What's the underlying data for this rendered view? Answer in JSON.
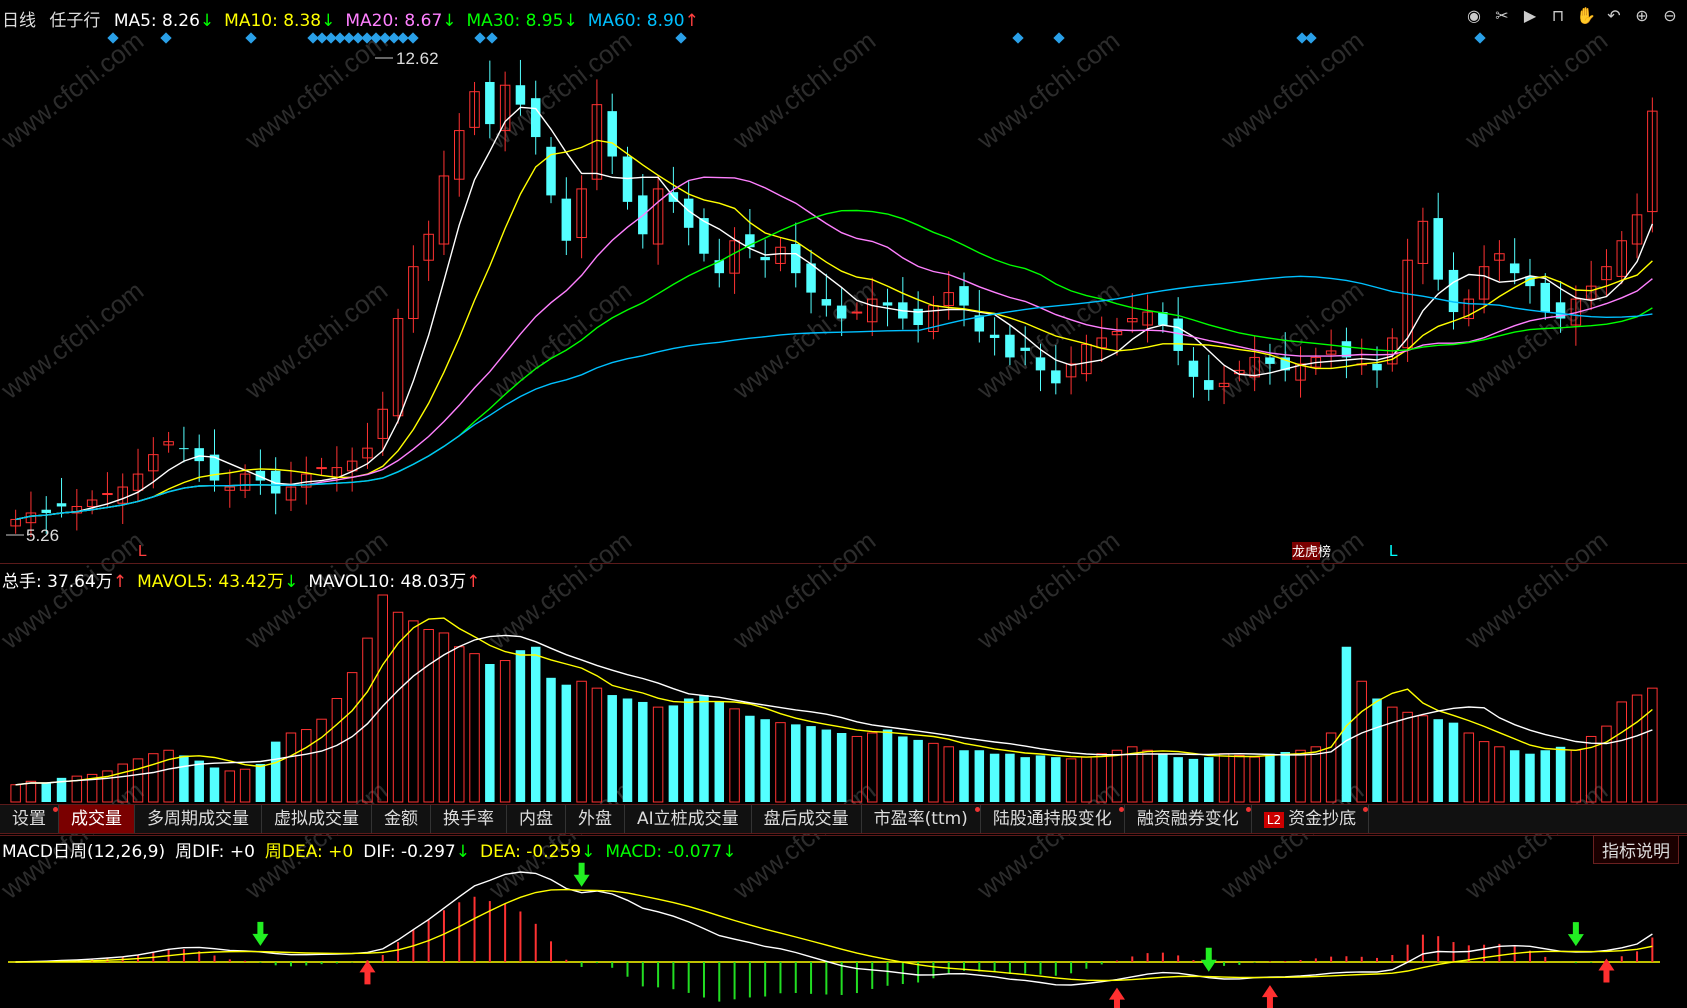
{
  "header": {
    "period": "日线",
    "stock": "任子行",
    "ma": [
      {
        "label": "MA5: 8.26",
        "arrow": "↓",
        "color": "#ffffff"
      },
      {
        "label": "MA10: 8.38",
        "arrow": "↓",
        "color": "#ffff00"
      },
      {
        "label": "MA20: 8.67",
        "arrow": "↓",
        "color": "#ff80ff"
      },
      {
        "label": "MA30: 8.95",
        "arrow": "↓",
        "color": "#00ff00"
      },
      {
        "label": "MA60: 8.90",
        "arrow": "↑",
        "color": "#00c0ff"
      }
    ]
  },
  "toolbar_icons": [
    "eye-icon",
    "scissors-icon",
    "play-icon",
    "lock-icon",
    "hand-icon",
    "undo-icon",
    "zoom-in-icon",
    "zoom-out-icon"
  ],
  "price_pane": {
    "high_label": "12.62",
    "low_label": "5.26",
    "markers": [
      "L",
      "L"
    ],
    "tag": "龙虎榜"
  },
  "volume_pane": {
    "items": [
      {
        "label": "总手: 37.64万",
        "arrow": "↑",
        "color": "#ffffff"
      },
      {
        "label": "MAVOL5: 43.42万",
        "arrow": "↓",
        "color": "#ffff00"
      },
      {
        "label": "MAVOL10: 48.03万",
        "arrow": "↑",
        "color": "#ffffff"
      }
    ]
  },
  "tabs": [
    {
      "label": "设置",
      "dot": true,
      "active": false
    },
    {
      "label": "成交量",
      "dot": false,
      "active": true
    },
    {
      "label": "多周期成交量",
      "dot": false,
      "active": false
    },
    {
      "label": "虚拟成交量",
      "dot": false,
      "active": false
    },
    {
      "label": "金额",
      "dot": false,
      "active": false
    },
    {
      "label": "换手率",
      "dot": false,
      "active": false
    },
    {
      "label": "内盘",
      "dot": false,
      "active": false
    },
    {
      "label": "外盘",
      "dot": false,
      "active": false
    },
    {
      "label": "AI立桩成交量",
      "dot": false,
      "active": false
    },
    {
      "label": "盘后成交量",
      "dot": false,
      "active": false
    },
    {
      "label": "市盈率(ttm)",
      "dot": true,
      "active": false
    },
    {
      "label": "陆股通持股变化",
      "dot": true,
      "active": false
    },
    {
      "label": "融资融券变化",
      "dot": true,
      "active": false
    },
    {
      "label": "资金抄底",
      "dot": true,
      "active": false,
      "l2": "L2"
    }
  ],
  "macd_pane": {
    "items": [
      {
        "label": "MACD日周(12,26,9)",
        "arrow": "",
        "color": "#ffffff"
      },
      {
        "label": "周DIF: +0",
        "arrow": "",
        "color": "#ffffff"
      },
      {
        "label": "周DEA: +0",
        "arrow": "",
        "color": "#ffff00"
      },
      {
        "label": "DIF: -0.297",
        "arrow": "↓",
        "color": "#ffffff"
      },
      {
        "label": "DEA: -0.259",
        "arrow": "↓",
        "color": "#ffff00"
      },
      {
        "label": "MACD: -0.077",
        "arrow": "↓",
        "color": "#00ff00"
      }
    ],
    "explain_button": "指标说明"
  },
  "watermark": "www.cfchi.com",
  "chart_data": {
    "type": "candlestick",
    "y_range_price": [
      5.26,
      12.62
    ],
    "close": [
      5.5,
      5.6,
      5.6,
      5.7,
      5.7,
      5.8,
      5.9,
      6.0,
      6.2,
      6.5,
      6.7,
      6.6,
      6.4,
      6.1,
      6.0,
      6.2,
      6.1,
      5.9,
      6.0,
      6.2,
      6.3,
      6.3,
      6.4,
      6.6,
      7.2,
      8.6,
      9.4,
      9.9,
      10.8,
      11.5,
      12.1,
      11.6,
      12.2,
      11.9,
      11.4,
      10.5,
      9.8,
      10.6,
      11.9,
      11.1,
      10.4,
      9.9,
      10.6,
      10.4,
      10.0,
      9.6,
      9.3,
      9.8,
      9.7,
      9.5,
      9.7,
      9.3,
      9.0,
      8.8,
      8.6,
      8.7,
      8.9,
      8.8,
      8.6,
      8.5,
      8.8,
      9.0,
      8.8,
      8.4,
      8.3,
      8.0,
      8.1,
      7.8,
      7.6,
      7.9,
      8.2,
      8.3,
      8.4,
      8.6,
      8.7,
      8.5,
      8.1,
      7.7,
      7.5,
      7.6,
      7.8,
      8.0,
      7.9,
      7.8,
      7.9,
      8.0,
      8.1,
      8.0,
      7.9,
      7.8,
      8.3,
      9.5,
      10.1,
      9.2,
      8.7,
      8.9,
      9.4,
      9.6,
      9.3,
      9.1,
      8.7,
      8.6,
      8.9,
      9.1,
      9.4,
      9.8,
      10.2,
      11.8
    ],
    "volume": [
      10,
      12,
      11,
      14,
      15,
      16,
      18,
      22,
      25,
      28,
      30,
      27,
      24,
      20,
      18,
      19,
      22,
      35,
      40,
      42,
      48,
      60,
      75,
      95,
      120,
      110,
      105,
      100,
      98,
      90,
      86,
      80,
      82,
      88,
      90,
      72,
      68,
      70,
      66,
      62,
      60,
      58,
      55,
      56,
      60,
      62,
      58,
      54,
      50,
      48,
      46,
      45,
      44,
      42,
      40,
      38,
      40,
      42,
      38,
      36,
      34,
      32,
      30,
      30,
      28,
      28,
      26,
      27,
      26,
      25,
      26,
      28,
      30,
      32,
      30,
      28,
      26,
      25,
      26,
      28,
      27,
      26,
      28,
      29,
      30,
      32,
      40,
      90,
      70,
      60,
      55,
      52,
      50,
      48,
      46,
      40,
      35,
      32,
      30,
      28,
      30,
      32,
      30,
      38,
      44,
      58,
      62,
      66
    ],
    "ma_series": [
      {
        "name": "MA5",
        "color": "#ffffff"
      },
      {
        "name": "MA10",
        "color": "#ffff00"
      },
      {
        "name": "MA20",
        "color": "#ff80ff"
      },
      {
        "name": "MA30",
        "color": "#00ff00"
      },
      {
        "name": "MA60",
        "color": "#00c0ff"
      }
    ]
  }
}
